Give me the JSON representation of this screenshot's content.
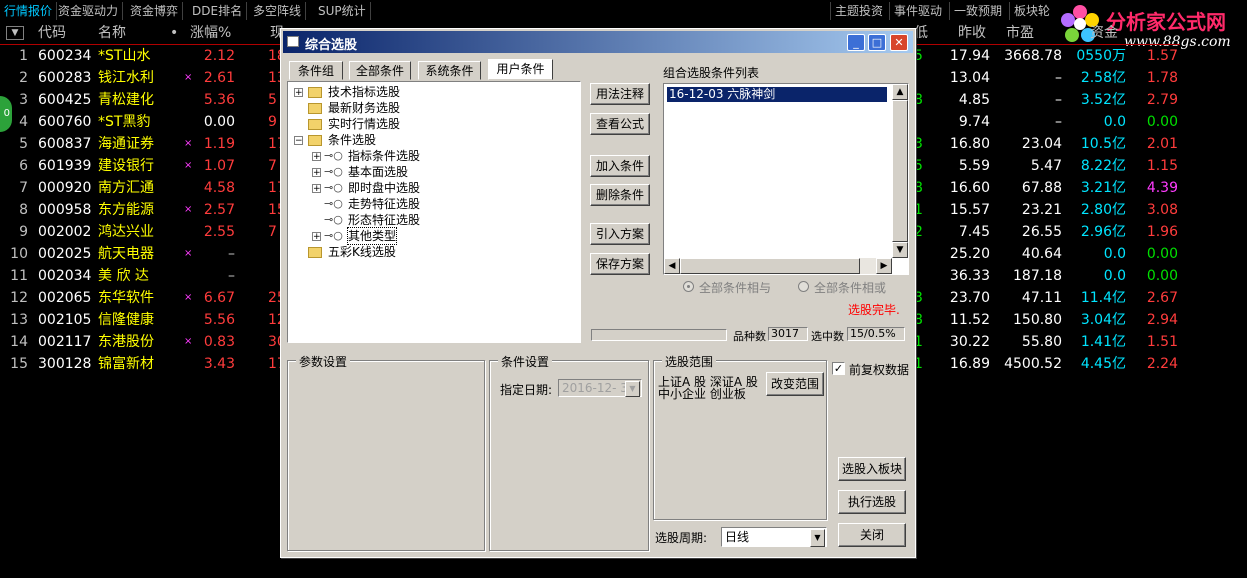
{
  "topbar": {
    "left_tabs": [
      "行情报价",
      "资金驱动力",
      "资金博弈",
      "DDE排名",
      "多空阵线",
      "SUP统计"
    ],
    "right_tabs": [
      "主题投资",
      "事件驱动",
      "一致预期",
      "板块轮"
    ]
  },
  "logo": {
    "brand": "分析家公式网",
    "url": "www.88gs.com"
  },
  "header": {
    "dropdown": "▼",
    "code": "代码",
    "name": "名称",
    "dot": "•",
    "pct": "涨幅%",
    "price": "现",
    "col_di": "低",
    "prev_close": "昨收",
    "pe": "市盈",
    "vol": "资金"
  },
  "side_badge": "0",
  "rows": [
    {
      "idx": "1",
      "code": "600234",
      "name": "*ST山水",
      "star": "",
      "pct": "2.12",
      "pct_color": "#ff3c3c",
      "r1": "17.94",
      "r2": "3668.78",
      "r3": "0550万",
      "r4": "1.57",
      "r4_color": "#ff3c3c"
    },
    {
      "idx": "2",
      "code": "600283",
      "name": "钱江水利",
      "star": "×",
      "pct": "2.61",
      "pct_color": "#ff3c3c",
      "r1": "13.04",
      "r2": "–",
      "r3": "2.58亿",
      "r4": "1.78",
      "r4_color": "#ff3c3c"
    },
    {
      "idx": "3",
      "code": "600425",
      "name": "青松建化",
      "star": "",
      "pct": "5.36",
      "pct_color": "#ff3c3c",
      "r1": "4.85",
      "r2": "–",
      "r3": "3.52亿",
      "r4": "2.79",
      "r4_color": "#ff3c3c"
    },
    {
      "idx": "4",
      "code": "600760",
      "name": "*ST黑豹",
      "star": "",
      "pct": "0.00",
      "pct_color": "#ffffff",
      "r1": "9.74",
      "r2": "–",
      "r3": "0.0",
      "r4": "0.00",
      "r4_color": "#00e000"
    },
    {
      "idx": "5",
      "code": "600837",
      "name": "海通证券",
      "star": "×",
      "pct": "1.19",
      "pct_color": "#ff3c3c",
      "r1": "16.80",
      "r2": "23.04",
      "r3": "10.5亿",
      "r4": "2.01",
      "r4_color": "#ff3c3c"
    },
    {
      "idx": "6",
      "code": "601939",
      "name": "建设银行",
      "star": "×",
      "pct": "1.07",
      "pct_color": "#ff3c3c",
      "r1": "5.59",
      "r2": "5.47",
      "r3": "8.22亿",
      "r4": "1.15",
      "r4_color": "#ff3c3c"
    },
    {
      "idx": "7",
      "code": "000920",
      "name": "南方汇通",
      "star": "",
      "pct": "4.58",
      "pct_color": "#ff3c3c",
      "r1": "16.60",
      "r2": "67.88",
      "r3": "3.21亿",
      "r4": "4.39",
      "r4_color": "#ff3cff"
    },
    {
      "idx": "8",
      "code": "000958",
      "name": "东方能源",
      "star": "×",
      "pct": "2.57",
      "pct_color": "#ff3c3c",
      "r1": "15.57",
      "r2": "23.21",
      "r3": "2.80亿",
      "r4": "3.08",
      "r4_color": "#ff3c3c"
    },
    {
      "idx": "9",
      "code": "002002",
      "name": "鸿达兴业",
      "star": "",
      "pct": "2.55",
      "pct_color": "#ff3c3c",
      "r1": "7.45",
      "r2": "26.55",
      "r3": "2.96亿",
      "r4": "1.96",
      "r4_color": "#ff3c3c"
    },
    {
      "idx": "10",
      "code": "002025",
      "name": "航天电器",
      "star": "×",
      "pct": "–",
      "pct_color": "#c0c0c0",
      "r1": "25.20",
      "r2": "40.64",
      "r3": "0.0",
      "r4": "0.00",
      "r4_color": "#00e000"
    },
    {
      "idx": "11",
      "code": "002034",
      "name": "美 欣 达",
      "star": "",
      "pct": "–",
      "pct_color": "#c0c0c0",
      "r1": "36.33",
      "r2": "187.18",
      "r3": "0.0",
      "r4": "0.00",
      "r4_color": "#00e000"
    },
    {
      "idx": "12",
      "code": "002065",
      "name": "东华软件",
      "star": "×",
      "pct": "6.67",
      "pct_color": "#ff3c3c",
      "r1": "23.70",
      "r2": "47.11",
      "r3": "11.4亿",
      "r4": "2.67",
      "r4_color": "#ff3c3c"
    },
    {
      "idx": "13",
      "code": "002105",
      "name": "信隆健康",
      "star": "",
      "pct": "5.56",
      "pct_color": "#ff3c3c",
      "r1": "11.52",
      "r2": "150.80",
      "r3": "3.04亿",
      "r4": "2.94",
      "r4_color": "#ff3c3c"
    },
    {
      "idx": "14",
      "code": "002117",
      "name": "东港股份",
      "star": "×",
      "pct": "0.83",
      "pct_color": "#ff3c3c",
      "r1": "30.22",
      "r2": "55.80",
      "r3": "1.41亿",
      "r4": "1.51",
      "r4_color": "#ff3c3c"
    },
    {
      "idx": "15",
      "code": "300128",
      "name": "锦富新材",
      "star": "",
      "pct": "3.43",
      "pct_color": "#ff3c3c",
      "r1": "16.89",
      "r2": "4500.52",
      "r3": "4.45亿",
      "r4": "2.24",
      "r4_color": "#ff3c3c"
    }
  ],
  "partial_cols": {
    "price": [
      "18",
      "13",
      "5",
      "9",
      "17",
      "7",
      "17",
      "15",
      "7",
      "",
      "",
      "25",
      "12",
      "30",
      "17"
    ],
    "lowdigit": [
      "5",
      "",
      "8",
      "",
      "3",
      "5",
      "8",
      "1",
      "2",
      "",
      "",
      "3",
      "8",
      "1",
      "1"
    ]
  },
  "dialog": {
    "title": "综合选股",
    "tabs": [
      "条件组",
      "全部条件",
      "系统条件",
      "用户条件"
    ],
    "tree": [
      {
        "label": "技术指标选股"
      },
      {
        "label": "最新财务选股"
      },
      {
        "label": "实时行情选股"
      },
      {
        "label": "条件选股"
      },
      {
        "label": "指标条件选股"
      },
      {
        "label": "基本面选股"
      },
      {
        "label": "即时盘中选股"
      },
      {
        "label": "走势特征选股"
      },
      {
        "label": "形态特征选股"
      },
      {
        "label": "其他类型"
      },
      {
        "label": "五彩K线选股"
      }
    ],
    "buttons": {
      "usage": "用法注释",
      "view_formula": "查看公式",
      "add_cond": "加入条件",
      "del_cond": "删除条件",
      "import_plan": "引入方案",
      "save_plan": "保存方案",
      "to_block": "选股入板块",
      "execute": "执行选股",
      "close": "关闭",
      "change_range": "改变范围"
    },
    "cond_list_label": "组合选股条件列表",
    "cond_list_item": "16-12-03 六脉神剑",
    "radio_and": "全部条件相与",
    "radio_or": "全部条件相或",
    "status": "选股完毕.",
    "variety_label": "品种数",
    "variety_value": "3017",
    "selected_label": "选中数",
    "selected_value": "15/0.5%",
    "param_group": "参数设置",
    "cond_group": "条件设置",
    "date_label": "指定日期:",
    "date_value": "2016-12- 3",
    "range_group": "选股范围",
    "range_lines": [
      "上证A 股  深证A 股",
      "中小企业  创业板"
    ],
    "restore_label": "前复权数据",
    "period_label": "选股周期:",
    "period_value": "日线",
    "status_color": "#ff0000"
  }
}
